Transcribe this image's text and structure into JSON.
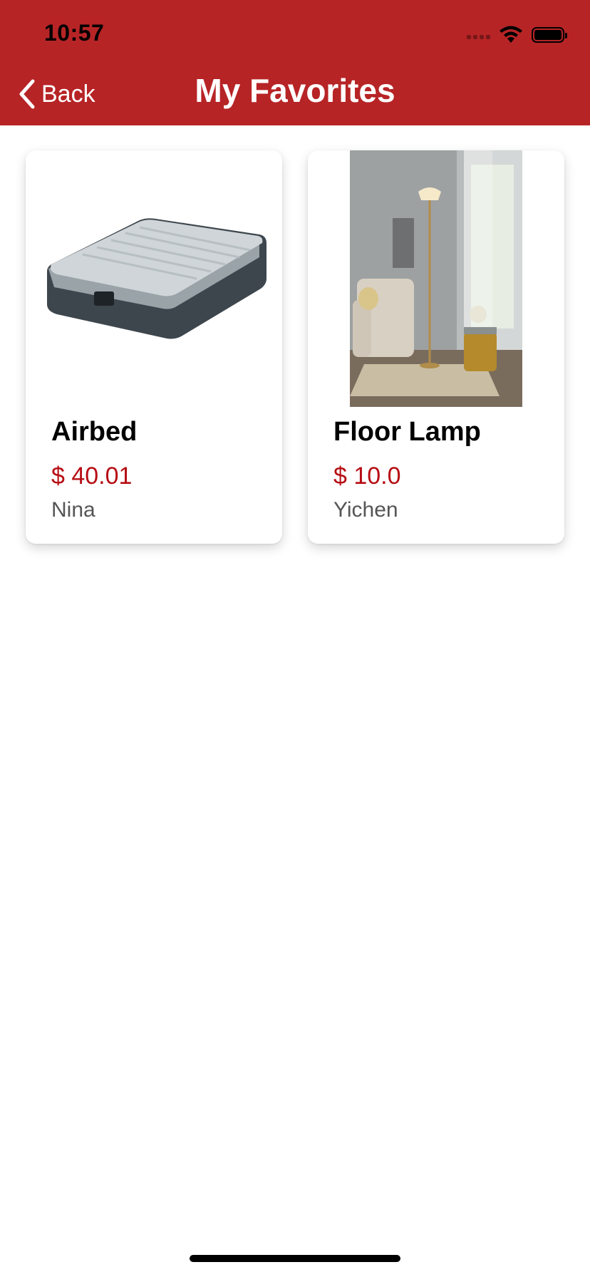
{
  "status_bar": {
    "time": "10:57",
    "icons": [
      "signal-icon",
      "wifi-icon",
      "battery-icon"
    ]
  },
  "nav": {
    "back_label": "Back",
    "title": "My Favorites",
    "background": "#b72426"
  },
  "favorites": [
    {
      "title": "Airbed",
      "price": "$ 40.01",
      "seller": "Nina",
      "image": "airbed-image"
    },
    {
      "title": "Floor Lamp",
      "price": "$ 10.0",
      "seller": "Yichen",
      "image": "floor-lamp-image"
    }
  ],
  "colors": {
    "header": "#b72426",
    "price": "#b60e14",
    "seller": "#555555"
  }
}
